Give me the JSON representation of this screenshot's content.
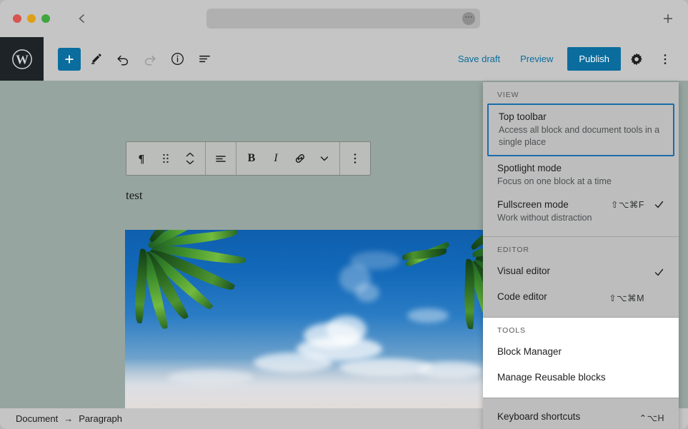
{
  "browser": {
    "back_icon": "chevron-left-icon",
    "url_value": "",
    "url_placeholder": "",
    "url_more_icon": "ellipsis-icon",
    "new_tab_icon": "plus-icon",
    "traffic_lights": [
      "close",
      "minimize",
      "maximize"
    ]
  },
  "header": {
    "logo_icon": "wordpress-logo-icon",
    "tools": [
      {
        "name": "add-block-button",
        "icon": "plus-icon",
        "label": "Add block"
      },
      {
        "name": "edit-tool-button",
        "icon": "pencil-icon",
        "label": "Tools"
      },
      {
        "name": "undo-button",
        "icon": "undo-icon",
        "label": "Undo"
      },
      {
        "name": "redo-button",
        "icon": "redo-icon",
        "label": "Redo",
        "disabled": true
      },
      {
        "name": "details-button",
        "icon": "info-icon",
        "label": "Details"
      },
      {
        "name": "list-view-button",
        "icon": "list-view-icon",
        "label": "List view"
      }
    ],
    "save_draft_label": "Save draft",
    "preview_label": "Preview",
    "publish_label": "Publish",
    "settings_icon": "gear-icon",
    "more_icon": "ellipsis-vertical-icon",
    "accent_color": "#0b6d9e",
    "link_color": "#0a6d9c"
  },
  "block_toolbar": {
    "buttons": [
      {
        "name": "block-type-button",
        "icon": "paragraph-icon"
      },
      {
        "name": "drag-handle",
        "icon": "drag-dots-icon"
      },
      {
        "name": "move-updown-button",
        "icon": "chevron-updown-icon"
      },
      {
        "name": "align-button",
        "icon": "align-text-icon"
      },
      {
        "name": "bold-button",
        "icon": "bold-icon",
        "label": "B"
      },
      {
        "name": "italic-button",
        "icon": "italic-icon",
        "label": "I"
      },
      {
        "name": "link-button",
        "icon": "link-icon"
      },
      {
        "name": "more-rich-text-button",
        "icon": "chevron-down-icon"
      },
      {
        "name": "block-options-button",
        "icon": "ellipsis-vertical-icon"
      }
    ]
  },
  "content": {
    "paragraph_text": "test",
    "image_alt": "palm trees against blue sky with clouds"
  },
  "breadcrumb": {
    "items": [
      "Document",
      "Paragraph"
    ],
    "separator": "→"
  },
  "menu": {
    "sections": [
      {
        "label": "VIEW",
        "items": [
          {
            "title": "Top toolbar",
            "desc": "Access all block and document tools in a single place",
            "shortcut": "",
            "checked": false,
            "focused": true
          },
          {
            "title": "Spotlight mode",
            "desc": "Focus on one block at a time",
            "shortcut": "",
            "checked": false,
            "focused": false
          },
          {
            "title": "Fullscreen mode",
            "desc": "Work without distraction",
            "shortcut": "⇧⌥⌘F",
            "checked": true,
            "focused": false
          }
        ]
      },
      {
        "label": "EDITOR",
        "items": [
          {
            "title": "Visual editor",
            "desc": "",
            "shortcut": "",
            "checked": true,
            "focused": false
          },
          {
            "title": "Code editor",
            "desc": "",
            "shortcut": "⇧⌥⌘M",
            "checked": false,
            "focused": false
          }
        ]
      },
      {
        "label": "TOOLS",
        "white": true,
        "items": [
          {
            "title": "Block Manager",
            "desc": "",
            "shortcut": "",
            "checked": false,
            "focused": false
          },
          {
            "title": "Manage Reusable blocks",
            "desc": "",
            "shortcut": "",
            "checked": false,
            "focused": false
          }
        ]
      },
      {
        "label": "",
        "items": [
          {
            "title": "Keyboard shortcuts",
            "desc": "",
            "shortcut": "⌃⌥H",
            "checked": false,
            "focused": false
          }
        ]
      }
    ],
    "focus_border_color": "#1a6ca8"
  }
}
